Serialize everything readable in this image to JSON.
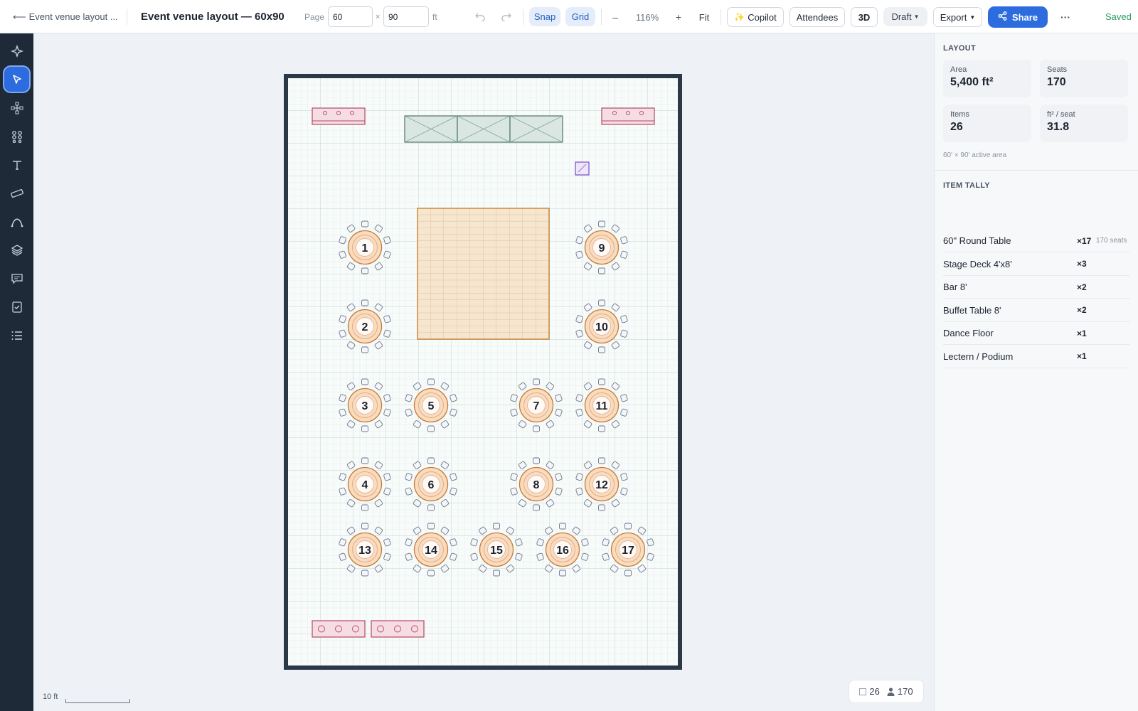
{
  "topbar": {
    "back_label": "Event venue layout ...",
    "doc_title": "Event venue layout — 60x90",
    "page_label": "Page",
    "width_value": "60",
    "height_value": "90",
    "times": "×",
    "unit": "ft",
    "snap": "Snap",
    "grid": "Grid",
    "zoom_out": "–",
    "zoom": "116%",
    "zoom_in": "+",
    "fit": "Fit",
    "copilot": "Copilot",
    "attendees": "Attendees",
    "view3d": "3D",
    "status": "Draft",
    "export": "Export",
    "share": "Share",
    "more": "···",
    "saved": "Saved",
    "accent": "#2d6cdf",
    "saved_color": "#2a9d5c"
  },
  "tools": [
    "sparkle-icon",
    "pointer-icon",
    "nodes-icon",
    "components-icon",
    "text-icon",
    "ruler-icon",
    "pen-icon",
    "layers-icon",
    "comment-icon",
    "checklist-icon",
    "list-icon"
  ],
  "floorplan": {
    "tables": [
      "1",
      "2",
      "3",
      "4",
      "5",
      "6",
      "7",
      "8",
      "9",
      "10",
      "11",
      "12",
      "13",
      "14",
      "15",
      "16",
      "17"
    ]
  },
  "scale_label": "10 ft",
  "status_bar": {
    "items": "26",
    "seats": "170"
  },
  "panel": {
    "layout_title": "LAYOUT",
    "area_label": "Area",
    "area_value": "5,400 ft²",
    "seats_label": "Seats",
    "seats_value": "170",
    "items_label": "Items",
    "items_value": "26",
    "ftseat_label": "ft² / seat",
    "ftseat_value": "31.8",
    "active_area": "60' × 90' active area",
    "tally_title": "ITEM TALLY",
    "tally": [
      {
        "name": "60\" Round Table",
        "count": "×17",
        "extra": "170 seats"
      },
      {
        "name": "Stage Deck 4'x8'",
        "count": "×3",
        "extra": ""
      },
      {
        "name": "Bar 8'",
        "count": "×2",
        "extra": ""
      },
      {
        "name": "Buffet Table 8'",
        "count": "×2",
        "extra": ""
      },
      {
        "name": "Dance Floor",
        "count": "×1",
        "extra": ""
      },
      {
        "name": "Lectern / Podium",
        "count": "×1",
        "extra": ""
      }
    ]
  }
}
